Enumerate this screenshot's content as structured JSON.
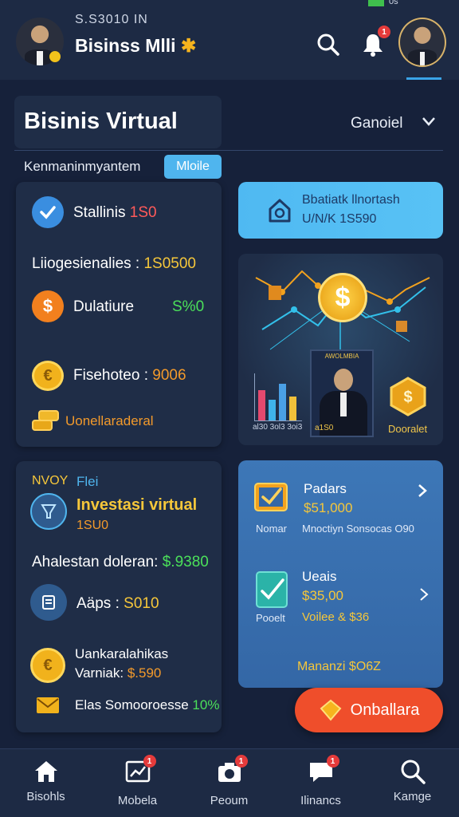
{
  "status_bar": {
    "right_text": "0s"
  },
  "header": {
    "small_text": "S.S3010 IN",
    "app_title": "Bisinss Mlli",
    "title_symbol": "✱",
    "notification_badge": "1"
  },
  "page": {
    "title": "Bisinis Virtual",
    "select_value": "Ganoiel",
    "subtitle": "Kenmaninmyantem",
    "mode_pill": "Mloile"
  },
  "stats_card": {
    "item1_label": "Stallinis",
    "item1_value": "1S0",
    "item2_label": "Liiogesienalies :",
    "item2_value": "1S0500",
    "item3_label": "Dulatiure",
    "item3_value": "S%0",
    "item4_label": "Fisehoteo :",
    "item4_value": "9006",
    "item5_label": "Uonellaraderal"
  },
  "action_button": {
    "line1": "Bbatiatk llnortash",
    "line2": "U/N/K 1S590"
  },
  "illustration": {
    "chart_caption": "al30 3ol3 3oi3",
    "photo_caption": "a1S0",
    "photo_header": "AWOLMBIA",
    "coin_label": "Dooralet"
  },
  "investment_card": {
    "tag1": "NVOY",
    "tag2": "Flei",
    "title": "Investasi virtual",
    "title_value": "1SU0",
    "balance_label": "Ahalestan doleran:",
    "balance_value": "$.9380",
    "apps_label": "Aäps :",
    "apps_value": "S010",
    "item_title": "Uankaralahikas",
    "item_label": "Varniak:",
    "item_value": "$.590",
    "footer_label": "Elas Somooroesse",
    "footer_value": "10%"
  },
  "tasks_card": {
    "task1_title": "Padars",
    "task1_amount": "$51,000",
    "task1_caption": "Nomar",
    "task1_desc": "Mnoctiyn Sonsocas O90",
    "task2_title": "Ueais",
    "task2_amount": "$35,00",
    "task2_caption": "Pooelt",
    "task2_desc": "Voilee & $36",
    "footer": "Mananzi $O6Z"
  },
  "cta": {
    "label": "Onballara"
  },
  "bottom_nav": [
    {
      "label": "Bisohls",
      "icon": "home-icon"
    },
    {
      "label": "Mobela",
      "icon": "chart-icon",
      "badge": "1"
    },
    {
      "label": "Peoum",
      "icon": "camera-icon",
      "badge": "1"
    },
    {
      "label": "Ilinancs",
      "icon": "message-icon",
      "badge": "1"
    },
    {
      "label": "Kamge",
      "icon": "search-icon"
    }
  ],
  "colors": {
    "background": "#16213a",
    "card": "#1f2d47",
    "accent_blue": "#4fb9f2",
    "accent_orange": "#ef4e2b",
    "value_yellow": "#f6c73a",
    "value_green": "#4be05a",
    "value_red": "#ff5a5a"
  }
}
